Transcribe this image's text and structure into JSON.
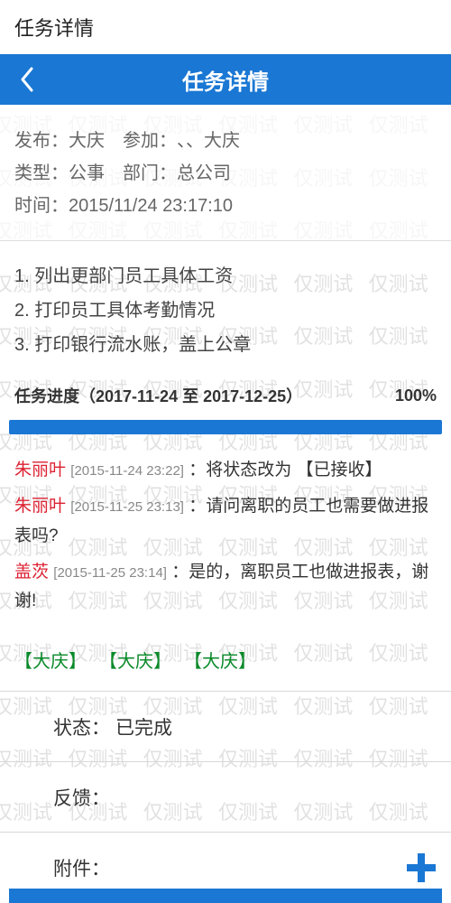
{
  "topbar": {
    "title": "任务详情"
  },
  "navbar": {
    "title": "任务详情"
  },
  "meta": {
    "publish_label": "发布：",
    "publish_value": "大庆",
    "join_label": "参加：",
    "join_value": "、、大庆",
    "type_label": "类型：",
    "type_value": "公事",
    "dept_label": "部门：",
    "dept_value": "总公司",
    "time_label": "时间：",
    "time_value": "2015/11/24 23:17:10"
  },
  "tasks": [
    "1. 列出更部门员工具体工资",
    "2. 打印员工具体考勤情况",
    "3. 打印银行流水账，盖上公章"
  ],
  "progress": {
    "label": "任务进度（2017-11-24 至 2017-12-25）",
    "percent": "100%"
  },
  "comments": [
    {
      "name": "朱丽叶",
      "time": "[2015-11-24 23:22]",
      "text": "：将状态改为 【已接收】"
    },
    {
      "name": "朱丽叶",
      "time": "[2015-11-25 23:13]",
      "text": "：请问离职的员工也需要做进报表吗?"
    },
    {
      "name": "盖茨",
      "time": "[2015-11-25 23:14]",
      "text": "：是的，离职员工也做进报表，谢谢!"
    }
  ],
  "tags": [
    "【大庆】",
    "【大庆】",
    "【大庆】"
  ],
  "status": {
    "label": "状态：",
    "value": "已完成"
  },
  "feedback": {
    "label": "反馈：",
    "value": ""
  },
  "attachment": {
    "label": "附件："
  },
  "watermark": "仅测试"
}
